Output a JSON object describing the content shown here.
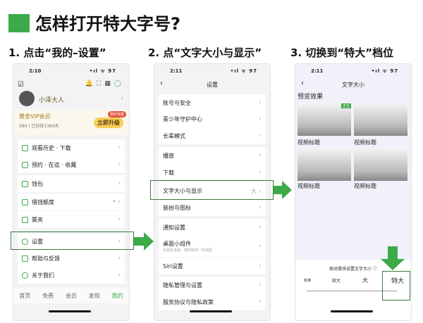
{
  "title": "怎样打开特大字号?",
  "steps": [
    "1. 点击“我的–设置”",
    "2. 点“文字大小与显示”",
    "3. 切换到“特大”档位"
  ],
  "phone1": {
    "time": "2:10",
    "signal": "•ıl ᯤ 97",
    "user": "小泽大人",
    "vip": "黄金VIP会员",
    "vip_info": "589 | 已持续1384天",
    "badge": "限时特惠",
    "upgrade": "立即升级",
    "rows": [
      "观看历史 · 下载",
      "预约 · 在追 · 收藏",
      "钱包",
      "借钱额度",
      "票夹",
      "设置",
      "帮助与反馈",
      "关于我们"
    ],
    "tabs": [
      "首页",
      "免费",
      "会员",
      "发现",
      "我的"
    ]
  },
  "phone2": {
    "time": "2:11",
    "signal": "•ıl ᯤ 97",
    "title": "设置",
    "rows": [
      "账号与安全",
      "青少年守护中心",
      "长辈模式",
      "播放",
      "下载",
      "文字大小与显示",
      "装扮与图标",
      "通知设置",
      "桌面小组件",
      "Siri设置",
      "隐私管理与设置",
      "服务协议与隐私政策"
    ],
    "widget_sub": "添加至桌面，随时畅快一份追剧",
    "text_size_value": "大"
  },
  "phone3": {
    "time": "2:11",
    "signal": "•ıl ᯤ 97",
    "title": "文字大小",
    "preview": "预览效果",
    "tag": "正在",
    "captions": [
      "视频标题",
      "视频标题",
      "视频标题",
      "视频标题"
    ],
    "hint": "拖动滑块设置文字大小 ⓘ",
    "levels": [
      "标准",
      "较大",
      "大",
      "特大"
    ],
    "selected_level": "特大"
  },
  "colors": {
    "accent": "#3daa4a"
  }
}
